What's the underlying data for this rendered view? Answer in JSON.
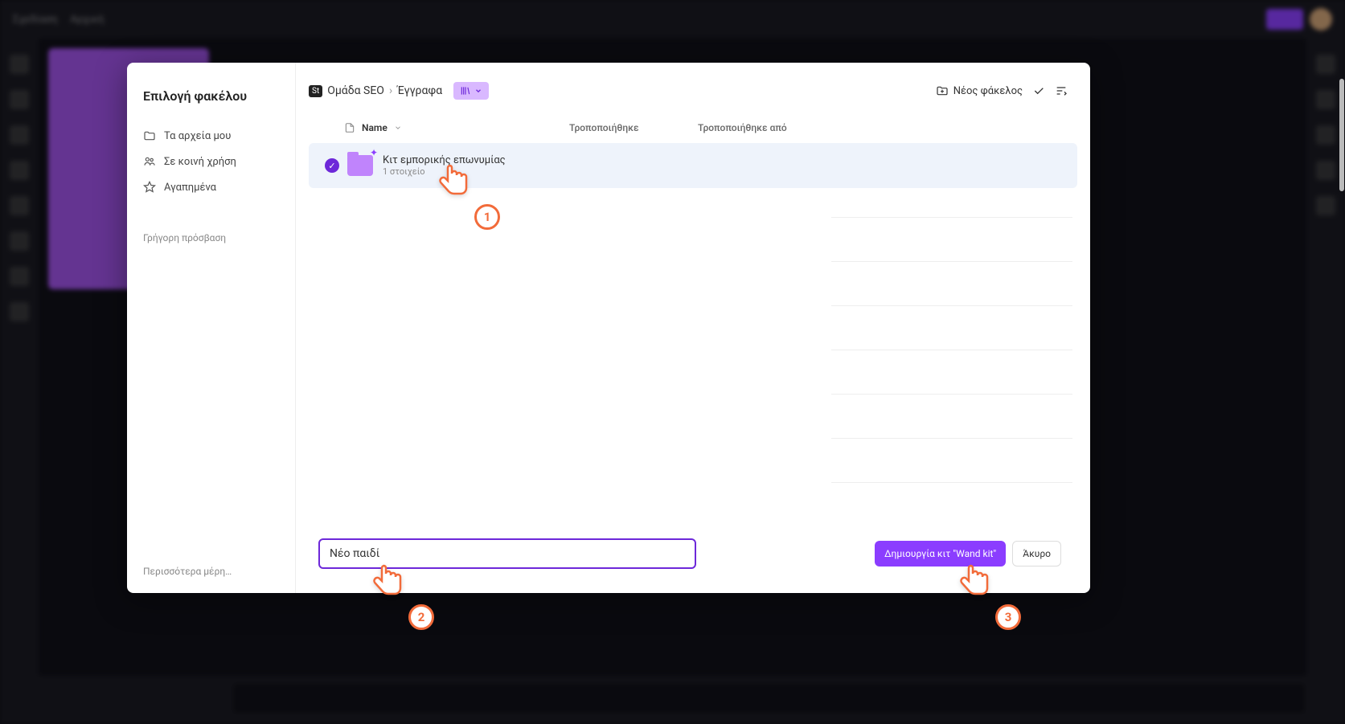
{
  "bg": {
    "nav1": "Σχεδίαση",
    "nav2": "Αρχική"
  },
  "modal": {
    "title": "Επιλογή φακέλου",
    "sidebar": {
      "my_files": "Τα αρχεία μου",
      "shared": "Σε κοινή χρήση",
      "favorites": "Αγαπημένα",
      "quick_access": "Γρήγορη πρόσβαση",
      "more_places": "Περισσότερα μέρη…"
    },
    "breadcrumb": {
      "chip": "St",
      "team": "Ομάδα SEO",
      "folder": "Έγγραφα"
    },
    "header_actions": {
      "new_folder": "Νέος φάκελος"
    },
    "table": {
      "col_name": "Name",
      "col_modified": "Τροποποιήθηκε",
      "col_modified_by": "Τροποποιήθηκε από",
      "rows": [
        {
          "title": "Κιτ εμπορικής επωνυμίας",
          "sub": "1 στοιχείο"
        }
      ]
    },
    "footer": {
      "input_value": "Νέο παιδί",
      "create_btn": "Δημιουργία κιτ \"Wand kit\"",
      "cancel_btn": "Άκυρο"
    }
  },
  "annotations": {
    "cursor1": "1",
    "cursor2": "2",
    "cursor3": "3"
  }
}
